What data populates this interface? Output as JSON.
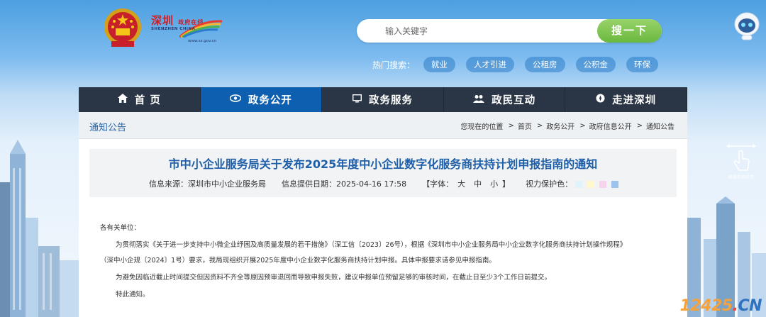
{
  "header": {
    "logo_text": "深圳",
    "logo_small": "政府在线",
    "logo_sub": "SHENZHEN CHINA",
    "logo_url": "www.sz.gov.cn"
  },
  "search": {
    "placeholder": "输入关键字",
    "button_label": "搜一下"
  },
  "hot_search": {
    "label": "热门搜索：",
    "tags": [
      "就业",
      "人才引进",
      "公租房",
      "公积金",
      "环保"
    ]
  },
  "nav": {
    "items": [
      {
        "label": "首 页",
        "icon": "home-icon",
        "active": false
      },
      {
        "label": "政务公开",
        "icon": "eye-icon",
        "active": true
      },
      {
        "label": "政务服务",
        "icon": "monitor-icon",
        "active": false
      },
      {
        "label": "政民互动",
        "icon": "users-icon",
        "active": false
      },
      {
        "label": "走进深圳",
        "icon": "compass-icon",
        "active": false
      }
    ]
  },
  "section": {
    "name": "通知公告"
  },
  "breadcrumb": {
    "prefix": "您现在的位置",
    "items": [
      "首页",
      "政务公开",
      "政府信息公开",
      "通知公告"
    ],
    "separator": ">"
  },
  "article": {
    "title": "市中小企业服务局关于发布2025年度中小企业数字化服务商扶持计划申报指南的通知",
    "source": "信息来源：深圳市中小企业服务局",
    "date": "信息提供日期：2025-04-16 17:58",
    "font_label": "【字体：",
    "font_sizes": [
      "大",
      "中",
      "小"
    ],
    "font_close": "】",
    "vision_label": "视力保护色：",
    "vision_colors": [
      "#dff3fb",
      "#fff8c8",
      "#f8d3ec",
      "#9cc3ee"
    ],
    "salutation": "各有关单位：",
    "paragraphs": [
      "为贯彻落实《关于进一步支持中小微企业纾困及高质量发展的若干措施》（深工信〔2023〕26号），根据《深圳市中小企业服务局中小企业数字化服务商扶持计划操作规程》",
      "（深中小企规〔2024〕1号）要求，我局现组织开展2025年度中小企业数字化服务商扶持计划申报。具体申报要求请参见申报指南。",
      "为避免因临近截止时间提交但因资料不齐全等原因预审退回而导致申报失败，建议申报单位预留足够的审核时间，在截止日至少3个工作日前提交。",
      "特此通知。"
    ]
  },
  "side": {
    "scroll_label": "触摸右侧延开"
  },
  "watermark": {
    "part_a": "12425",
    "part_b": ".",
    "part_c": "CN"
  }
}
